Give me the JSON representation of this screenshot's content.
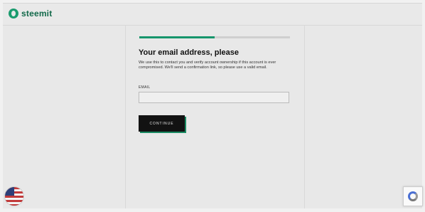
{
  "header": {
    "logo_text": "steemit"
  },
  "signup": {
    "progress_percent": 50,
    "title": "Your email address, please",
    "description": "We use this to contact you and verify account ownership if this account is ever compromised. We'll send a confirmation link, so please use a valid email.",
    "email_label": "EMAIL",
    "email_value": "",
    "continue_label": "CONTINUE"
  },
  "footer": {
    "language_flag": "us-flag-icon",
    "recaptcha": "recaptcha-icon"
  },
  "colors": {
    "accent": "#16956c",
    "button_bg": "#121212",
    "logo_text": "#12694a"
  }
}
